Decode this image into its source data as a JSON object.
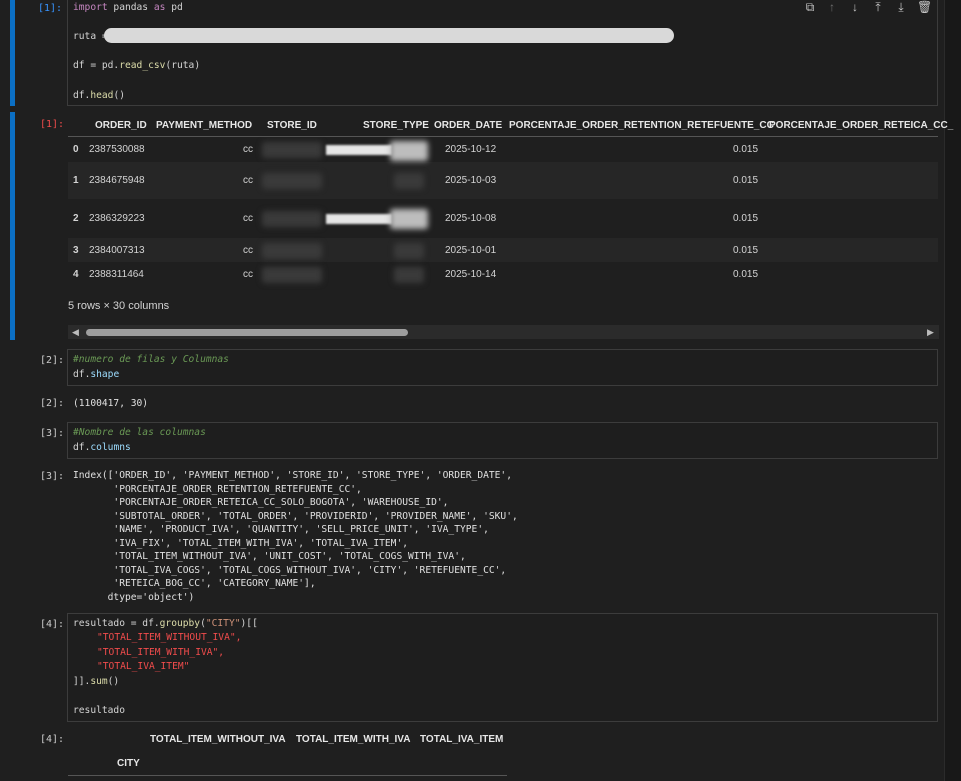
{
  "cells": {
    "c1": {
      "prompt": "[1]:",
      "code_lines": [
        "import pandas as pd",
        "ruta =",
        "df = pd.read_csv(ruta)",
        "df.head()"
      ]
    },
    "out1": {
      "prompt": "[1]:",
      "columns": [
        "ORDER_ID",
        "PAYMENT_METHOD",
        "STORE_ID",
        "STORE_TYPE",
        "ORDER_DATE",
        "PORCENTAJE_ORDER_RETENTION_RETEFUENTE_CC",
        "PORCENTAJE_ORDER_RETEICA_CC_"
      ],
      "rows": [
        {
          "idx": "0",
          "order_id": "2387530088",
          "payment": "cc",
          "order_date": "2025-10-12",
          "retention": "0.015"
        },
        {
          "idx": "1",
          "order_id": "2384675948",
          "payment": "cc",
          "order_date": "2025-10-03",
          "retention": "0.015"
        },
        {
          "idx": "2",
          "order_id": "2386329223",
          "payment": "cc",
          "order_date": "2025-10-08",
          "retention": "0.015"
        },
        {
          "idx": "3",
          "order_id": "2384007313",
          "payment": "cc",
          "order_date": "2025-10-01",
          "retention": "0.015"
        },
        {
          "idx": "4",
          "order_id": "2388311464",
          "payment": "cc",
          "order_date": "2025-10-14",
          "retention": "0.015"
        }
      ],
      "summary": "5 rows × 30 columns",
      "scroll_left": "◀",
      "scroll_right": "▶"
    },
    "c2": {
      "prompt": "[2]:",
      "comment": "#numero de filas y Columnas",
      "obj": "df",
      "attr": "shape",
      "out_prompt": "[2]:",
      "output": "(1100417, 30)"
    },
    "c3": {
      "prompt": "[3]:",
      "comment": "#Nombre de las columnas",
      "obj": "df",
      "attr": "columns",
      "out_prompt": "[3]:",
      "output_lines": [
        "Index(['ORDER_ID', 'PAYMENT_METHOD', 'STORE_ID', 'STORE_TYPE', 'ORDER_DATE',",
        "       'PORCENTAJE_ORDER_RETENTION_RETEFUENTE_CC',",
        "       'PORCENTAJE_ORDER_RETEICA_CC_SOLO_BOGOTA', 'WAREHOUSE_ID',",
        "       'SUBTOTAL_ORDER', 'TOTAL_ORDER', 'PROVIDERID', 'PROVIDER_NAME', 'SKU',",
        "       'NAME', 'PRODUCT_IVA', 'QUANTITY', 'SELL_PRICE_UNIT', 'IVA_TYPE',",
        "       'IVA_FIX', 'TOTAL_ITEM_WITH_IVA', 'TOTAL_IVA_ITEM',",
        "       'TOTAL_ITEM_WITHOUT_IVA', 'UNIT_COST', 'TOTAL_COGS_WITH_IVA',",
        "       'TOTAL_IVA_COGS', 'TOTAL_COGS_WITHOUT_IVA', 'CITY', 'RETEFUENTE_CC',",
        "       'RETEICA_BOG_CC', 'CATEGORY_NAME'],",
        "      dtype='object')"
      ]
    },
    "c4": {
      "prompt": "[4]:",
      "line1_a": "resultado = df.",
      "line1_fn": "groupby",
      "line1_b": "(",
      "line1_str": "\"CITY\"",
      "line1_c": ")[[",
      "items": [
        "\"TOTAL_ITEM_WITHOUT_IVA\",",
        "\"TOTAL_ITEM_WITH_IVA\",",
        "\"TOTAL_IVA_ITEM\""
      ],
      "line5_a": "]].",
      "line5_fn": "sum",
      "line5_b": "()",
      "last_line": "resultado",
      "out_prompt": "[4]:",
      "out_columns": [
        "TOTAL_ITEM_WITHOUT_IVA",
        "TOTAL_ITEM_WITH_IVA",
        "TOTAL_IVA_ITEM"
      ],
      "index_name": "CITY"
    }
  },
  "toolbar": {
    "icons": [
      "copy-icon",
      "move-up-icon",
      "move-down-icon",
      "insert-above-icon",
      "insert-below-icon",
      "delete-icon"
    ]
  },
  "colors": {
    "accent": "#0b6fc4",
    "background": "#1f1f1f",
    "keyword": "#c586c0",
    "string": "#ce9178",
    "comment": "#6a9955"
  }
}
